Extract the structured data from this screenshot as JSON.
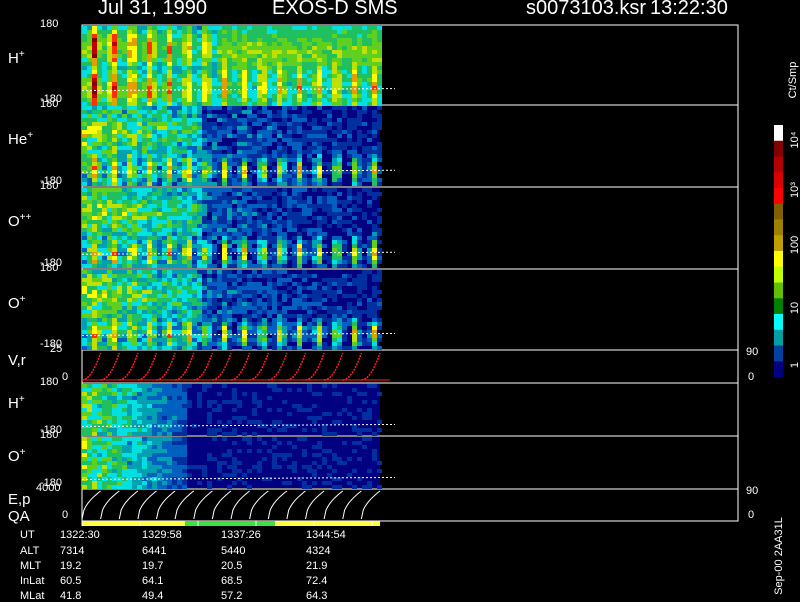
{
  "header": {
    "date": "Jul 31, 1990",
    "instrument": "EXOS-D SMS",
    "file": "s0073103.ksr",
    "time": "13:22:30"
  },
  "panels": [
    {
      "label": "H",
      "sup": "+",
      "ymax": "180",
      "ymin": "-180"
    },
    {
      "label": "He",
      "sup": "+",
      "ymax": "180",
      "ymin": "-180"
    },
    {
      "label": "O",
      "sup": "++",
      "ymax": "180",
      "ymin": "-180"
    },
    {
      "label": "O",
      "sup": "+",
      "ymax": "180",
      "ymin": "-180"
    },
    {
      "label": "V,r",
      "sup": "",
      "ymax": "25",
      "ymin": "0",
      "right_top": "90",
      "right_bot": "0"
    },
    {
      "label": "H",
      "sup": "+",
      "ymax": "180",
      "ymin": "-180"
    },
    {
      "label": "O",
      "sup": "+",
      "ymax": "180",
      "ymin": "-180"
    },
    {
      "label": "E,p",
      "sup": "",
      "ymax": "4000",
      "ymin": "0",
      "right_top": "90",
      "right_bot": "0"
    }
  ],
  "qa_label": "QA",
  "colorbar": {
    "unit": "Ct/Smp",
    "ticks": [
      "10⁴",
      "10³",
      "100",
      "10",
      "1"
    ],
    "colors": [
      "#ffffff",
      "#800000",
      "#b00000",
      "#d80000",
      "#ff0000",
      "#806000",
      "#a08000",
      "#c0a000",
      "#ffff00",
      "#c0ff00",
      "#60c000",
      "#008000",
      "#00ffff",
      "#00a0a0",
      "#0040a0",
      "#000080"
    ]
  },
  "side_label": "Sep-00 2AA31L",
  "table": {
    "row_labels": [
      "UT",
      "ALT",
      "MLT",
      "InLat",
      "MLat"
    ],
    "columns": [
      [
        "1322:30",
        "7314",
        "19.2",
        "60.5",
        "41.8"
      ],
      [
        "1329:58",
        "6441",
        "19.7",
        "64.1",
        "49.4"
      ],
      [
        "1337:26",
        "5440",
        "20.5",
        "68.5",
        "57.2"
      ],
      [
        "1344:54",
        "4324",
        "21.9",
        "72.4",
        "64.3"
      ]
    ]
  },
  "chart_data": {
    "type": "heatmap",
    "title": "Jul 31, 1990 EXOS-D SMS",
    "x_ticks": [
      "1322:30",
      "1329:58",
      "1337:26",
      "1344:54"
    ],
    "spin_pulses": 16,
    "species_panels": [
      "H+",
      "He+",
      "O++",
      "O+",
      "H+",
      "O+"
    ],
    "y_range_pitch": [
      -180,
      180
    ],
    "vr_range": [
      0,
      25
    ],
    "ep_range": [
      0,
      4000
    ],
    "color_scale": "log",
    "color_range": [
      1,
      10000
    ],
    "qa_segments": [
      {
        "from": "1322:30",
        "color": "#ffff40"
      },
      {
        "from": "1335:00",
        "color": "#40e040"
      },
      {
        "from": "1339:30",
        "color": "#ffff40"
      }
    ]
  }
}
